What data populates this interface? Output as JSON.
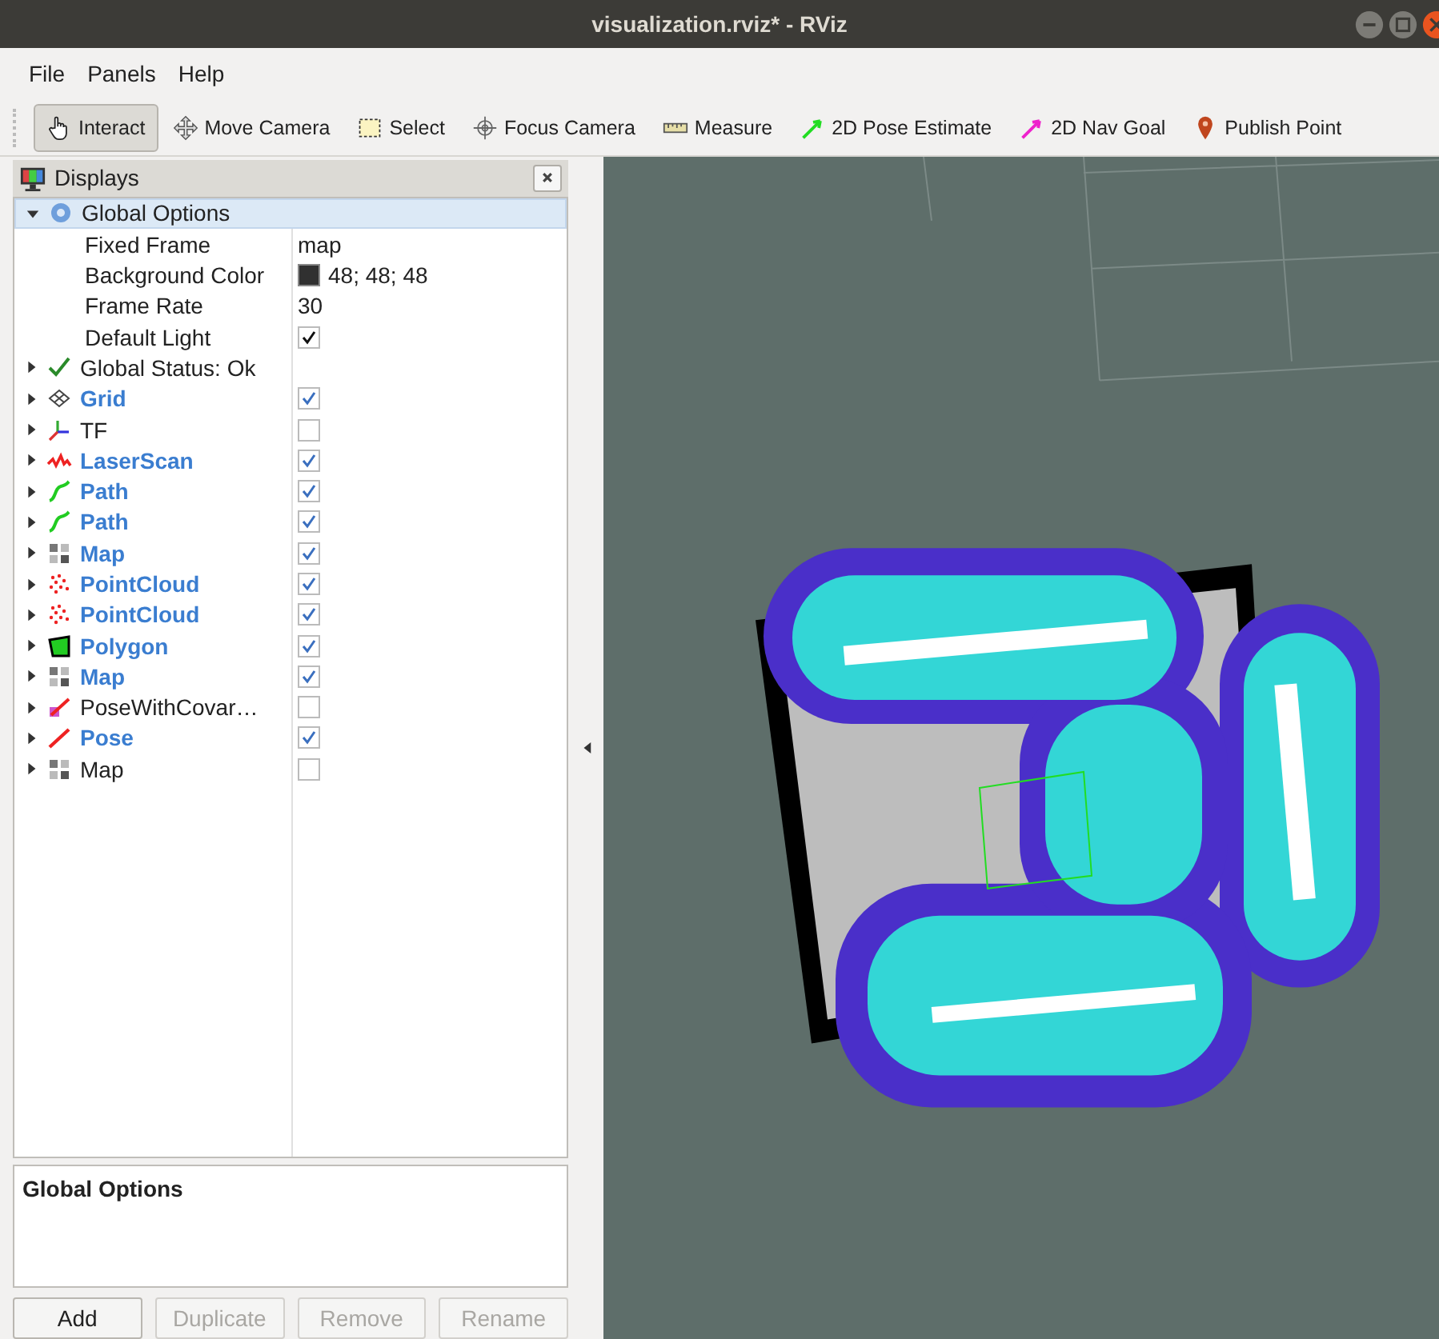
{
  "window": {
    "title": "visualization.rviz* - RViz"
  },
  "menu": [
    {
      "label": "File"
    },
    {
      "label": "Panels"
    },
    {
      "label": "Help"
    }
  ],
  "toolbar": [
    {
      "kind": "interact",
      "label": "Interact",
      "selected": true
    },
    {
      "kind": "move",
      "label": "Move Camera",
      "selected": false
    },
    {
      "kind": "select",
      "label": "Select",
      "selected": false
    },
    {
      "kind": "focus",
      "label": "Focus Camera",
      "selected": false
    },
    {
      "kind": "measure",
      "label": "Measure",
      "selected": false
    },
    {
      "kind": "pose",
      "label": "2D Pose Estimate",
      "selected": false
    },
    {
      "kind": "goal",
      "label": "2D Nav Goal",
      "selected": false
    },
    {
      "kind": "point",
      "label": "Publish Point",
      "selected": false
    }
  ],
  "displays": {
    "title": "Displays",
    "tree": [
      {
        "kind": "options",
        "label": "Global Options",
        "expanded": true,
        "selected": true,
        "children": [
          {
            "kind": "text",
            "name": "Fixed Frame",
            "value": "map"
          },
          {
            "kind": "color",
            "name": "Background Color",
            "value": "48; 48; 48",
            "color": "#303030"
          },
          {
            "kind": "text",
            "name": "Frame Rate",
            "value": "30"
          },
          {
            "kind": "checkbox",
            "name": "Default Light",
            "checked": true
          }
        ]
      },
      {
        "kind": "status",
        "label": "Global Status: Ok",
        "expanded": false,
        "selected": false
      },
      {
        "kind": "grid",
        "label": "Grid",
        "checked": true,
        "expanded": false,
        "selected": false
      },
      {
        "kind": "tf",
        "label": "TF",
        "checked": false,
        "expanded": false,
        "selected": false
      },
      {
        "kind": "laser",
        "label": "LaserScan",
        "checked": true,
        "expanded": false,
        "selected": false
      },
      {
        "kind": "path",
        "label": "Path",
        "checked": true,
        "expanded": false,
        "selected": false
      },
      {
        "kind": "path",
        "label": "Path",
        "checked": true,
        "expanded": false,
        "selected": false
      },
      {
        "kind": "map",
        "label": "Map",
        "checked": true,
        "expanded": false,
        "selected": false
      },
      {
        "kind": "cloud",
        "label": "PointCloud",
        "checked": true,
        "expanded": false,
        "selected": false
      },
      {
        "kind": "cloud",
        "label": "PointCloud",
        "checked": true,
        "expanded": false,
        "selected": false
      },
      {
        "kind": "polygon",
        "label": "Polygon",
        "checked": true,
        "expanded": false,
        "selected": false
      },
      {
        "kind": "map",
        "label": "Map",
        "checked": true,
        "expanded": false,
        "selected": false
      },
      {
        "kind": "posecov",
        "label": "PoseWithCovar…",
        "checked": false,
        "expanded": false,
        "selected": false
      },
      {
        "kind": "pose",
        "label": "Pose",
        "checked": true,
        "expanded": false,
        "selected": false
      },
      {
        "kind": "map",
        "label": "Map",
        "checked": false,
        "expanded": false,
        "selected": false
      }
    ]
  },
  "description": {
    "title": "Global Options"
  },
  "buttons": [
    {
      "label": "Add",
      "disabled": false
    },
    {
      "label": "Duplicate",
      "disabled": true
    },
    {
      "label": "Remove",
      "disabled": true
    },
    {
      "label": "Rename",
      "disabled": true
    }
  ]
}
